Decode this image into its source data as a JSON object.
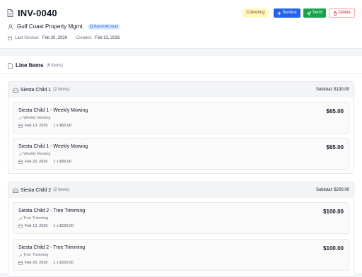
{
  "invoice": {
    "number": "INV-0040",
    "customer": "Gulf Coast Property Mgmt.",
    "parent_badge": "Parent Account",
    "last_service_label": "Last Service:",
    "last_service": "Feb 20, 2026",
    "created_label": "Created:",
    "created": "Feb 13, 2026",
    "status": "Collecting",
    "status_color": "#fef9c3"
  },
  "actions": {
    "service_label": "Service",
    "send_label": "Send",
    "delete_label": "Delete"
  },
  "line_items": {
    "title": "Line Items",
    "count": "(6 items)",
    "groups": [
      {
        "name": "Siesta Child 1",
        "count": "(2 items)",
        "subtotal": "Subtotal: $130.00",
        "items": [
          {
            "name": "Siesta Child 1 - Weekly Mowing",
            "service": "Weekly Mowing",
            "date": "Feb 13, 2026",
            "qty": "1 x $65.00",
            "price": "$65.00"
          },
          {
            "name": "Siesta Child 1 - Weekly Mowing",
            "service": "Weekly Mowing",
            "date": "Feb 20, 2026",
            "qty": "1 x $65.00",
            "price": "$65.00"
          }
        ]
      },
      {
        "name": "Siesta Child 2",
        "count": "(2 items)",
        "subtotal": "Subtotal: $200.00",
        "items": [
          {
            "name": "Siesta Child 2 - Tree Trimming",
            "service": "Tree Trimming",
            "date": "Feb 13, 2026",
            "qty": "1 x $100.00",
            "price": "$100.00"
          },
          {
            "name": "Siesta Child 2 - Tree Trimming",
            "service": "Tree Trimming",
            "date": "Feb 20, 2026",
            "qty": "1 x $100.00",
            "price": "$100.00"
          }
        ]
      }
    ]
  },
  "colors": {
    "service_button": "#2563eb",
    "send_button": "#16a34a",
    "delete_text": "#dc2626"
  },
  "icons": [
    "document-icon",
    "plus-icon",
    "send-icon",
    "trash-icon",
    "user-icon",
    "calendar-icon",
    "building-icon",
    "wrench-icon"
  ]
}
